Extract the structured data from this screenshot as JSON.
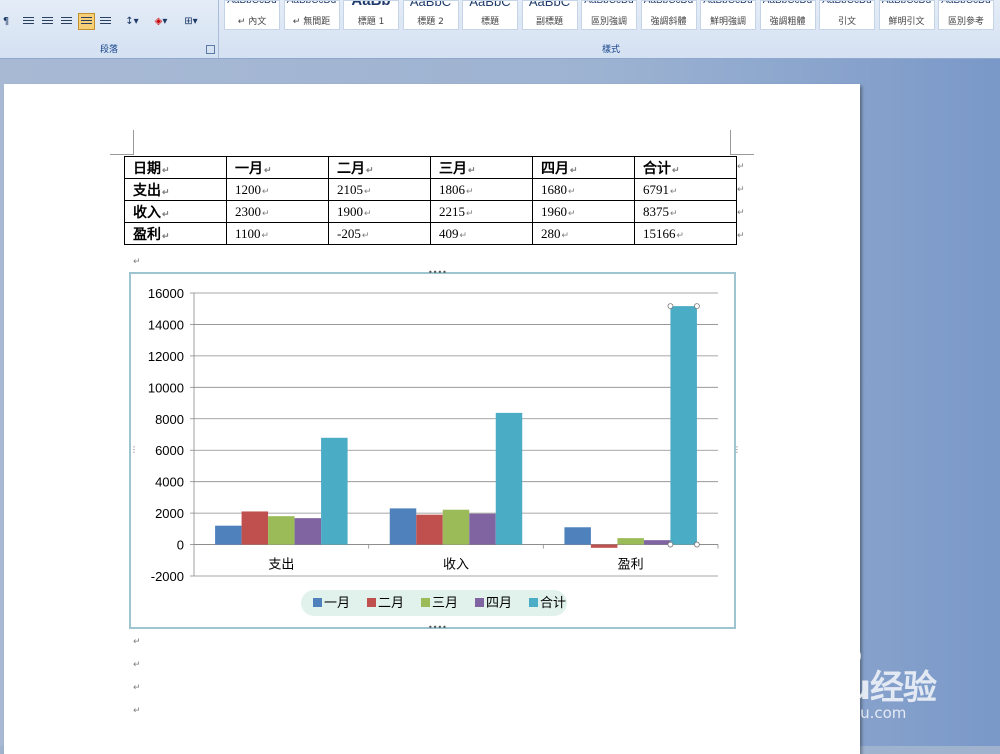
{
  "ribbon": {
    "paragraph_group_label": "段落",
    "styles_group_label": "樣式",
    "styles": [
      {
        "sample": "AaBbCcDd",
        "name": "↵ 內文",
        "size": "small"
      },
      {
        "sample": "AaBbCcDd",
        "name": "↵ 無間距",
        "size": "small"
      },
      {
        "sample": "AaBb",
        "name": "標題 1",
        "size": "big"
      },
      {
        "sample": "AaBbC",
        "name": "標題 2",
        "size": "mid"
      },
      {
        "sample": "AaBbC",
        "name": "標題",
        "size": "mid"
      },
      {
        "sample": "AaBbC",
        "name": "副標題",
        "size": "mid"
      },
      {
        "sample": "AaBbCcDd",
        "name": "區別強調",
        "size": "small"
      },
      {
        "sample": "AaBbCcDd",
        "name": "強調斜體",
        "size": "small"
      },
      {
        "sample": "AaBbCcDd",
        "name": "鮮明強調",
        "size": "small"
      },
      {
        "sample": "AaBbCcDd",
        "name": "強調粗體",
        "size": "small"
      },
      {
        "sample": "AaBbCcDd",
        "name": "引文",
        "size": "small"
      },
      {
        "sample": "AaBbCcDd",
        "name": "鮮明引文",
        "size": "small"
      },
      {
        "sample": "AaBbCcDd",
        "name": "區別參考",
        "size": "small"
      }
    ]
  },
  "table": {
    "rows": [
      [
        "日期",
        "一月",
        "二月",
        "三月",
        "四月",
        "合计"
      ],
      [
        "支出",
        "1200",
        "2105",
        "1806",
        "1680",
        "6791"
      ],
      [
        "收入",
        "2300",
        "1900",
        "2215",
        "1960",
        "8375"
      ],
      [
        "盈利",
        "1100",
        "-205",
        "409",
        "280",
        "15166"
      ]
    ],
    "paragraph_mark": "↵"
  },
  "chart_data": {
    "type": "bar",
    "categories": [
      "支出",
      "收入",
      "盈利"
    ],
    "series": [
      {
        "name": "一月",
        "values": [
          1200,
          2300,
          1100
        ],
        "color": "#4f81bd"
      },
      {
        "name": "二月",
        "values": [
          2105,
          1900,
          -205
        ],
        "color": "#c0504d"
      },
      {
        "name": "三月",
        "values": [
          1806,
          2215,
          409
        ],
        "color": "#9bbb59"
      },
      {
        "name": "四月",
        "values": [
          1680,
          1960,
          280
        ],
        "color": "#8064a2"
      },
      {
        "name": "合计",
        "values": [
          6791,
          8375,
          15166
        ],
        "color": "#4bacc6"
      }
    ],
    "ylim": [
      -2000,
      16000
    ],
    "yticks": [
      "16000",
      "14000",
      "12000",
      "10000",
      "8000",
      "6000",
      "4000",
      "2000",
      "0",
      "-2000"
    ],
    "grid": true,
    "legend": "bottom",
    "title": "",
    "xlabel": "",
    "ylabel": ""
  },
  "watermark": {
    "brand": "Baidu经验",
    "url": "jingyan.baidu.com"
  }
}
